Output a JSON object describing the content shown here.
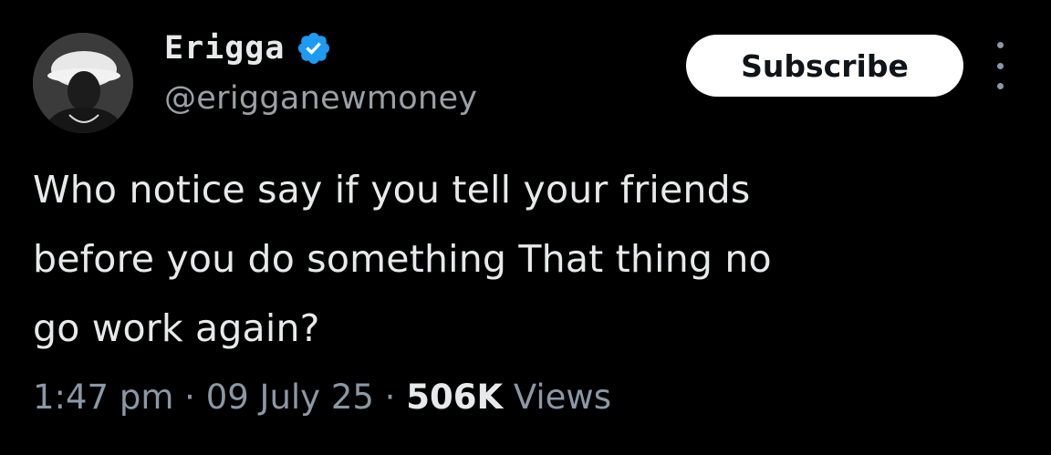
{
  "author": {
    "display_name": "Erigga",
    "handle": "@erigganewmoney",
    "verified_icon": "verified-badge-icon",
    "avatar": "profile-photo"
  },
  "actions": {
    "subscribe_label": "Subscribe",
    "more_icon": "more-options-icon"
  },
  "tweet": {
    "lines": [
      "Who notice say if you tell your friends",
      "before you do something That thing no",
      "go work again?"
    ]
  },
  "meta": {
    "time": "1:47 pm",
    "sep1": " · ",
    "date": "09 July 25",
    "sep2": " · ",
    "views_count": "506K",
    "views_label": " Views"
  },
  "colors": {
    "background": "#000000",
    "text": "#e7e9ea",
    "secondary": "#8b98a5",
    "verified": "#1d9bf0",
    "button_bg": "#ffffff"
  }
}
